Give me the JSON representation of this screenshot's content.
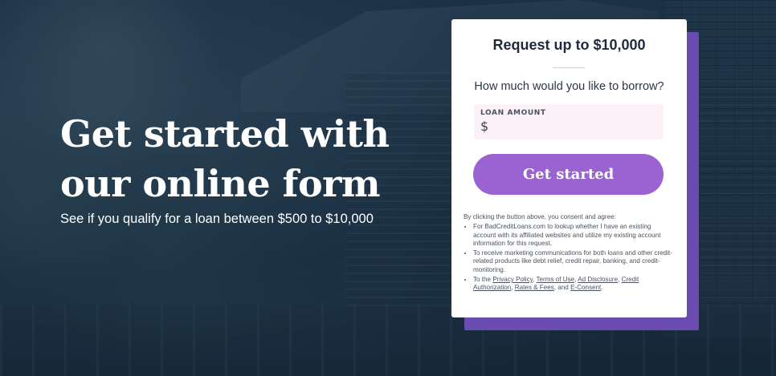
{
  "hero": {
    "headline": "Get started with our online form",
    "subheadline": "See if you qualify for a loan between $500 to $10,000"
  },
  "form": {
    "title": "Request up to $10,000",
    "question": "How much would you like to borrow?",
    "loan_amount_label": "LOAN AMOUNT",
    "currency_symbol": "$",
    "loan_amount_value": "",
    "cta_label": "Get started"
  },
  "disclaimer": {
    "intro": "By clicking the button above, you consent and agree:",
    "item1": "For BadCreditLoans.com to lookup whether I have an existing account with its affiliated websites and utilize my existing account information for this request.",
    "item2": "To receive marketing communications for both loans and other credit-related products like debt relief, credit repair, banking, and credit-monitoring.",
    "item3_prefix": "To the",
    "links": {
      "privacy_policy": "Privacy Policy",
      "terms_of_use": "Terms of Use",
      "ad_disclosure": "Ad Disclosure",
      "credit_authorization": "Credit Authorization",
      "rates_fees": "Rates & Fees",
      "e_consent": "E-Consent"
    },
    "sep_comma": ", ",
    "sep_and": ", and ",
    "end": "."
  },
  "colors": {
    "background": "#1d3347",
    "card_shadow": "#6a4bb0",
    "cta": "#9b62d1",
    "input_bg": "#fcf1f7"
  }
}
